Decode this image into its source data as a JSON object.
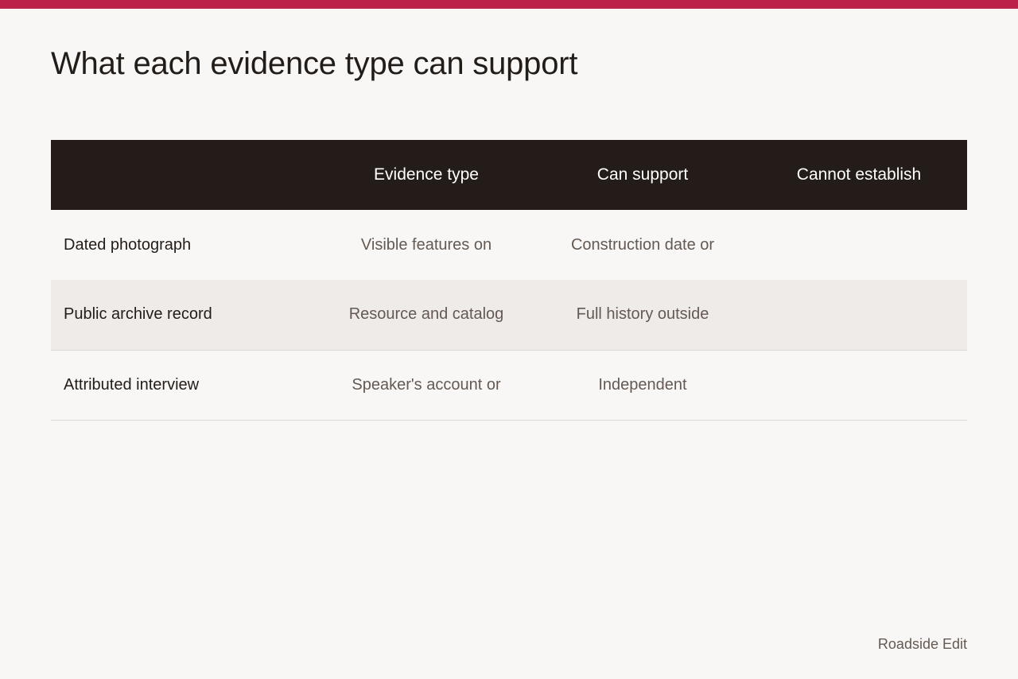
{
  "page": {
    "title": "What each evidence type can support",
    "brand": "Roadside Edit",
    "accent_color": "#bb2149"
  },
  "table": {
    "headers": [
      "",
      "Evidence type",
      "Can support",
      "Cannot establish"
    ],
    "rows": [
      {
        "label": "Dated photograph",
        "evidence_type": "Visible features on",
        "can_support": "Construction date or",
        "cannot_establish": ""
      },
      {
        "label": "Public archive record",
        "evidence_type": "Resource and catalog",
        "can_support": "Full history outside",
        "cannot_establish": ""
      },
      {
        "label": "Attributed interview",
        "evidence_type": "Speaker's account or",
        "can_support": "Independent",
        "cannot_establish": ""
      }
    ]
  }
}
